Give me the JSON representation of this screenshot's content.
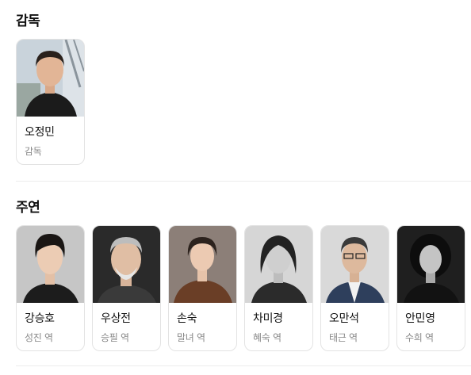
{
  "director_section": {
    "title": "감독",
    "people": [
      {
        "name": "오정민",
        "role": "감독"
      }
    ]
  },
  "cast_section": {
    "title": "주연",
    "people": [
      {
        "name": "강승호",
        "role": "성진 역"
      },
      {
        "name": "우상전",
        "role": "승필 역"
      },
      {
        "name": "손숙",
        "role": "말녀 역"
      },
      {
        "name": "차미경",
        "role": "혜숙 역"
      },
      {
        "name": "오만석",
        "role": "태근 역"
      },
      {
        "name": "안민영",
        "role": "수희 역"
      }
    ]
  }
}
